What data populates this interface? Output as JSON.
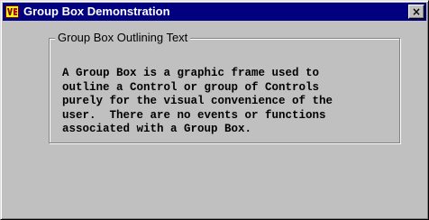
{
  "window": {
    "title": "Group Box Demonstration",
    "close_label": "×",
    "app_icon": "vb-app-icon"
  },
  "groupbox": {
    "label": "Group Box Outlining Text",
    "body": "A Group Box is a graphic frame used to\noutline a Control or group of Controls\npurely for the visual convenience of the\nuser.  There are no events or functions\nassociated with a Group Box."
  },
  "colors": {
    "titlebar": "#000080",
    "face": "#c0c0c0",
    "shadow": "#808080",
    "highlight": "#ffffff"
  }
}
